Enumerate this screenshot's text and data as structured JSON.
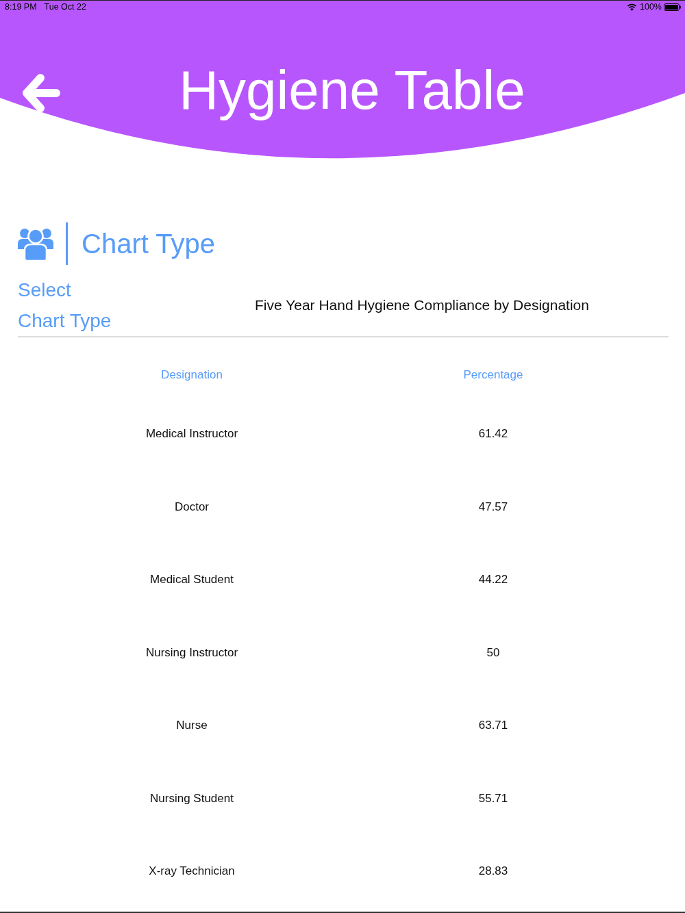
{
  "status_bar": {
    "time": "8:19 PM",
    "date": "Tue Oct 22",
    "battery": "100%"
  },
  "header": {
    "title": "Hygiene Table"
  },
  "section": {
    "title": "Chart Type",
    "picker_label": "Select Chart Type",
    "chart_title": "Five Year Hand Hygiene Compliance by Designation"
  },
  "table": {
    "columns": [
      "Designation",
      "Percentage"
    ],
    "rows": [
      [
        "Medical Instructor",
        "61.42"
      ],
      [
        "Doctor",
        "47.57"
      ],
      [
        "Medical Student",
        "44.22"
      ],
      [
        "Nursing Instructor",
        "50"
      ],
      [
        "Nurse",
        "63.71"
      ],
      [
        "Nursing Student",
        "55.71"
      ],
      [
        "X-ray Technician",
        "28.83"
      ]
    ]
  }
}
